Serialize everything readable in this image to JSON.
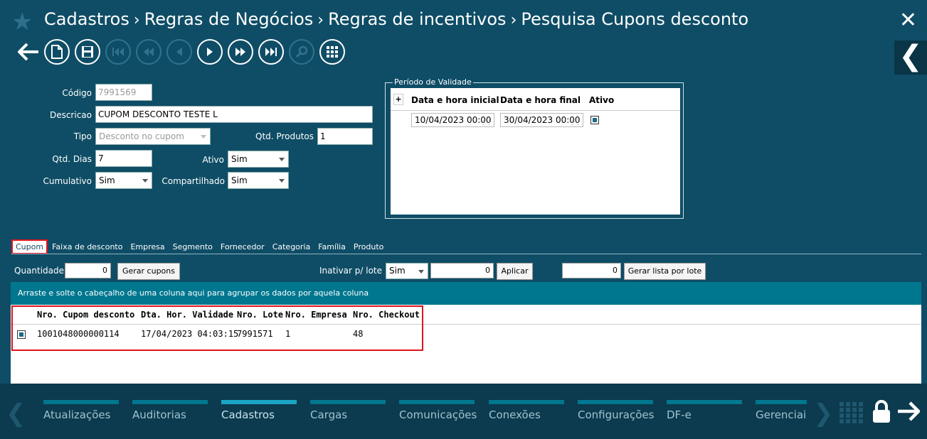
{
  "header": {
    "breadcrumb": [
      "Cadastros",
      "Regras de Negócios",
      "Regras de incentivos",
      "Pesquisa Cupons desconto"
    ],
    "close_label": "✕",
    "side_toggle": "❮"
  },
  "toolbar": {
    "buttons": [
      "back-arrow",
      "new-document",
      "save",
      "first",
      "previous-page",
      "previous",
      "next",
      "next-page",
      "last",
      "search",
      "grid-menu"
    ]
  },
  "form": {
    "codigo_label": "Código",
    "codigo_value": "7991569",
    "descricao_label": "Descricao",
    "descricao_value": "CUPOM DESCONTO TESTE L",
    "tipo_label": "Tipo",
    "tipo_value": "Desconto no cupom",
    "qtd_produtos_label": "Qtd. Produtos",
    "qtd_produtos_value": "1",
    "qtd_dias_label": "Qtd. Dias",
    "qtd_dias_value": "7",
    "ativo_label": "Ativo",
    "ativo_value": "Sim",
    "cumulativo_label": "Cumulativo",
    "cumulativo_value": "Sim",
    "compartilhado_label": "Compartilhado",
    "compartilhado_value": "Sim"
  },
  "periodo": {
    "legend": "Período de Validade",
    "add": "+",
    "col_inicial": "Data e hora inicial",
    "col_final": "Data e hora final",
    "col_ativo": "Ativo",
    "row": {
      "inicial": "10/04/2023 00:00",
      "final": "30/04/2023 00:00",
      "ativo": true
    }
  },
  "tabs": [
    "Cupom",
    "Faixa de desconto",
    "Empresa",
    "Segmento",
    "Fornecedor",
    "Categoria",
    "Família",
    "Produto"
  ],
  "actions": {
    "quantidade_label": "Quantidade",
    "quantidade_value": "0",
    "gerar_cupons": "Gerar cupons",
    "inativar_label": "Inativar p/ lote",
    "inativar_value": "Sim",
    "lote_value": "0",
    "aplicar": "Aplicar",
    "lista_value": "0",
    "gerar_lista": "Gerar lista por lote"
  },
  "grid": {
    "group_hint": "Arraste e solte o cabeçalho de uma coluna aqui para agrupar os dados por aquela coluna",
    "columns": [
      "Nro. Cupom desconto",
      "Dta. Hor. Validade",
      "Nro. Lote",
      "Nro. Empresa",
      "Nro. Checkout"
    ],
    "rows": [
      {
        "selected": true,
        "cupom": "1001048000000114",
        "validade": "17/04/2023 04:03:15",
        "lote": "7991571",
        "empresa": "1",
        "checkout": "48"
      }
    ]
  },
  "bottom_menu": {
    "items": [
      "Atualizações",
      "Auditorias",
      "Cadastros",
      "Cargas",
      "Comunicações",
      "Conexões",
      "Configurações",
      "DF-e",
      "Gerenciais"
    ],
    "active": "Cadastros",
    "left_arrow": "❮",
    "right_arrow": "❯"
  },
  "colors": {
    "background": "#0f4d66",
    "accent": "#00778f",
    "highlight": "#e0141c"
  }
}
